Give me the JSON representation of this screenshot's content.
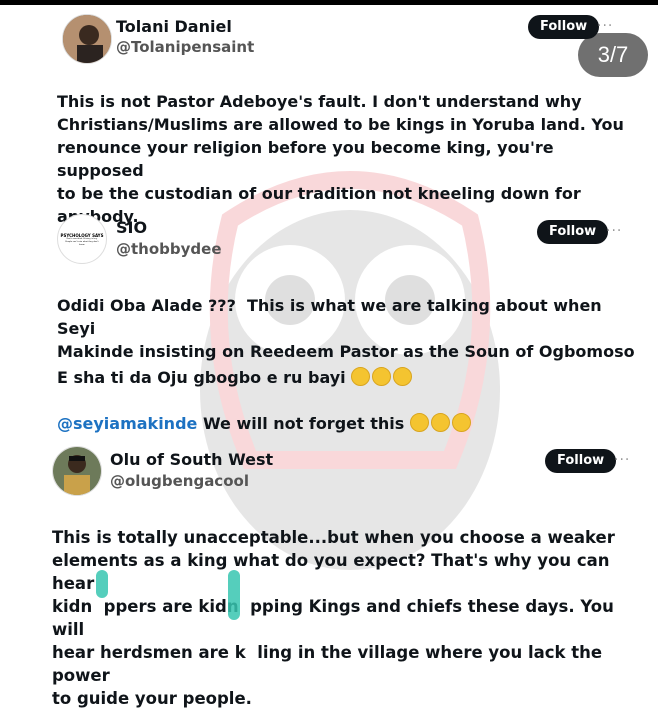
{
  "viewer": {
    "page_counter": "3/7"
  },
  "tweets": [
    {
      "name": "Tolani Daniel",
      "handle": "@Tolanipensaint",
      "follow_label": "Follow",
      "more": "···",
      "text": "This is not Pastor Adeboye's fault. I don't understand why\nChristians/Muslims are allowed to be kings in Yoruba land. You\nrenounce your religion before you become king, you're supposed\nto be the custodian of our tradition not kneeling down for\nanybody."
    },
    {
      "name": "SIO",
      "handle": "@thobbydee",
      "avatar_text": "PSYCHOLOGY SAYS",
      "avatar_subtext": "Don't overthink. Privacy is key. People can't ruin what they don't know.",
      "follow_label": "Follow",
      "more": "···",
      "text_line1": "Odidi Oba Alade ???  This is what we are talking about when Seyi\nMakinde insisting on Reedeem Pastor as the Soun of Ogbomoso",
      "text_line2": "E sha ti da Oju gbogbo e ru bayi",
      "mention": "@seyiamakinde",
      "text_line3": " We will not forget this"
    },
    {
      "name": "Olu of South West",
      "handle": "@olugbengacool",
      "follow_label": "Follow",
      "more": "···",
      "text": "This is totally unacceptable...but when you choose a weaker\nelements as a king what do you expect? That's why you can hear\nkidn  ppers are kidn  pping Kings and chiefs these days. You will\nhear herdsmen are k  ling in the village where you lack the power\nto guide your people."
    }
  ],
  "colors": {
    "accent": "#1d72c2",
    "button": "#0f1419",
    "counter": "#707070"
  }
}
